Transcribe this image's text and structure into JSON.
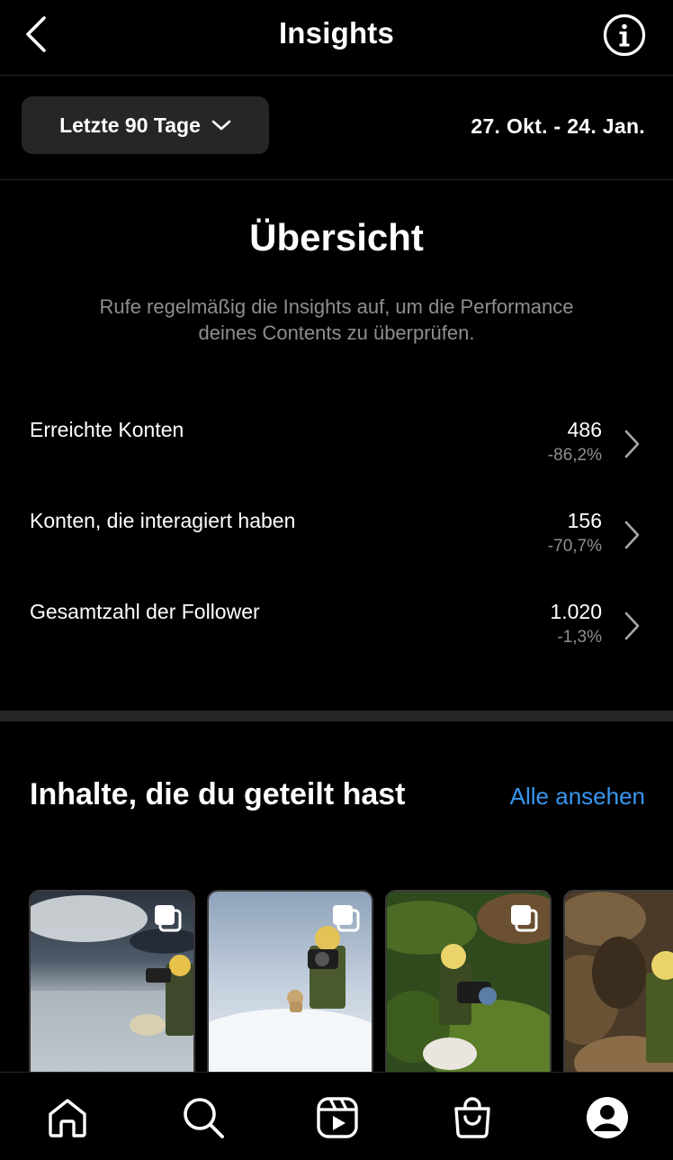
{
  "header": {
    "title": "Insights"
  },
  "filter": {
    "range_label": "Letzte 90 Tage",
    "date_range": "27. Okt. - 24. Jan."
  },
  "overview": {
    "title": "Übersicht",
    "description": "Rufe regelmäßig die Insights auf, um die Performance deines Contents zu überprüfen.",
    "metrics": [
      {
        "label": "Erreichte Konten",
        "value": "486",
        "change": "-86,2%"
      },
      {
        "label": "Konten, die interagiert haben",
        "value": "156",
        "change": "-70,7%"
      },
      {
        "label": "Gesamtzahl der Follower",
        "value": "1.020",
        "change": "-1,3%"
      }
    ]
  },
  "shared": {
    "title": "Inhalte, die du geteilt hast",
    "see_all": "Alle ansehen"
  },
  "colors": {
    "accent_link": "#3897f0",
    "background": "#000000",
    "surface": "#262626",
    "muted_text": "#8e8e8e"
  },
  "icons": {
    "back": "chevron-left-icon",
    "info": "info-circle-icon",
    "dropdown": "chevron-down-icon",
    "row_chevron": "chevron-right-icon",
    "multi_post": "carousel-icon",
    "nav": [
      "home-icon",
      "search-icon",
      "reels-icon",
      "shop-icon",
      "profile-icon"
    ]
  }
}
